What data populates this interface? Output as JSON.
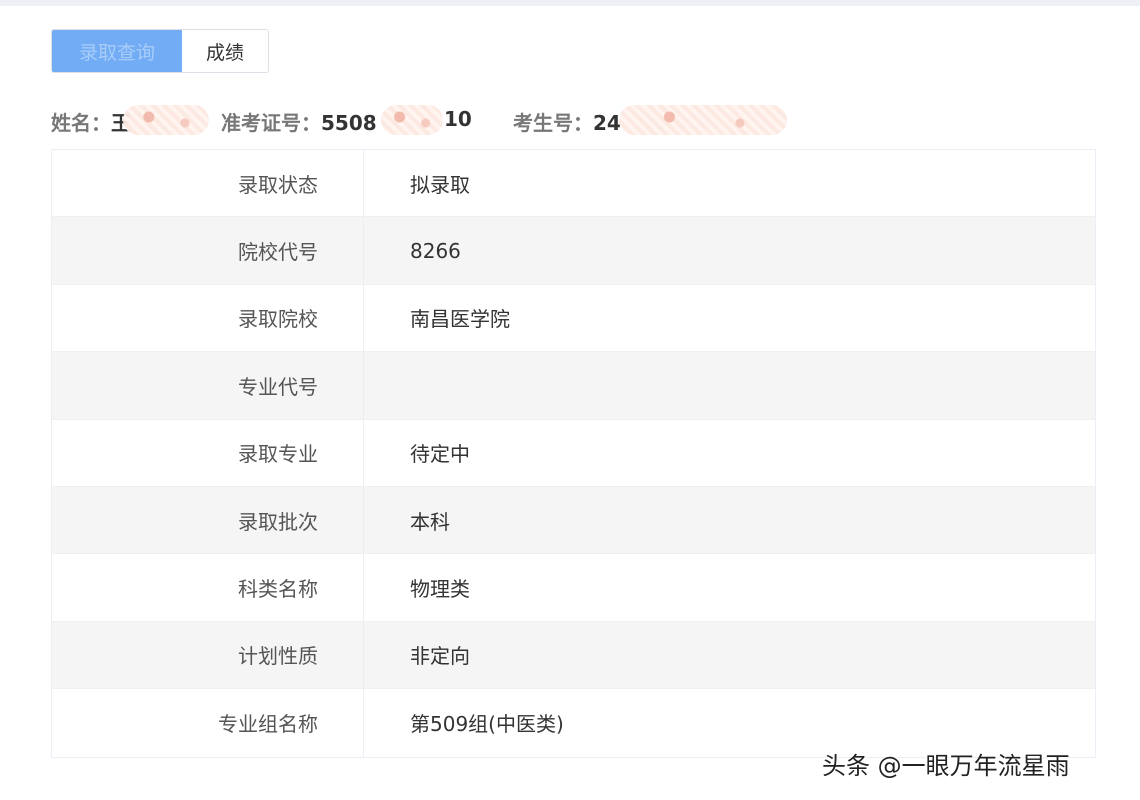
{
  "tabs": {
    "active_label": "录取查询",
    "scores_label": "成绩"
  },
  "info": {
    "name_label": "姓名：",
    "name_value": "王",
    "ticket_label": "准考证号：",
    "ticket_value": "5508",
    "ticket_value_end": "10",
    "exam_label": "考生号：",
    "exam_value": "24"
  },
  "table": {
    "rows": [
      {
        "label": "录取状态",
        "value": "拟录取"
      },
      {
        "label": "院校代号",
        "value": "8266"
      },
      {
        "label": "录取院校",
        "value": "南昌医学院"
      },
      {
        "label": "专业代号",
        "value": ""
      },
      {
        "label": "录取专业",
        "value": "待定中"
      },
      {
        "label": "录取批次",
        "value": "本科"
      },
      {
        "label": "科类名称",
        "value": "物理类"
      },
      {
        "label": "计划性质",
        "value": "非定向"
      },
      {
        "label": "专业组名称",
        "value": "第509组(中医类)"
      }
    ]
  },
  "watermark": "头条 @一眼万年流星雨",
  "colors": {
    "active_tab": "#71acf5",
    "stripe": "#f5f5f5",
    "border": "#ebeef5"
  }
}
